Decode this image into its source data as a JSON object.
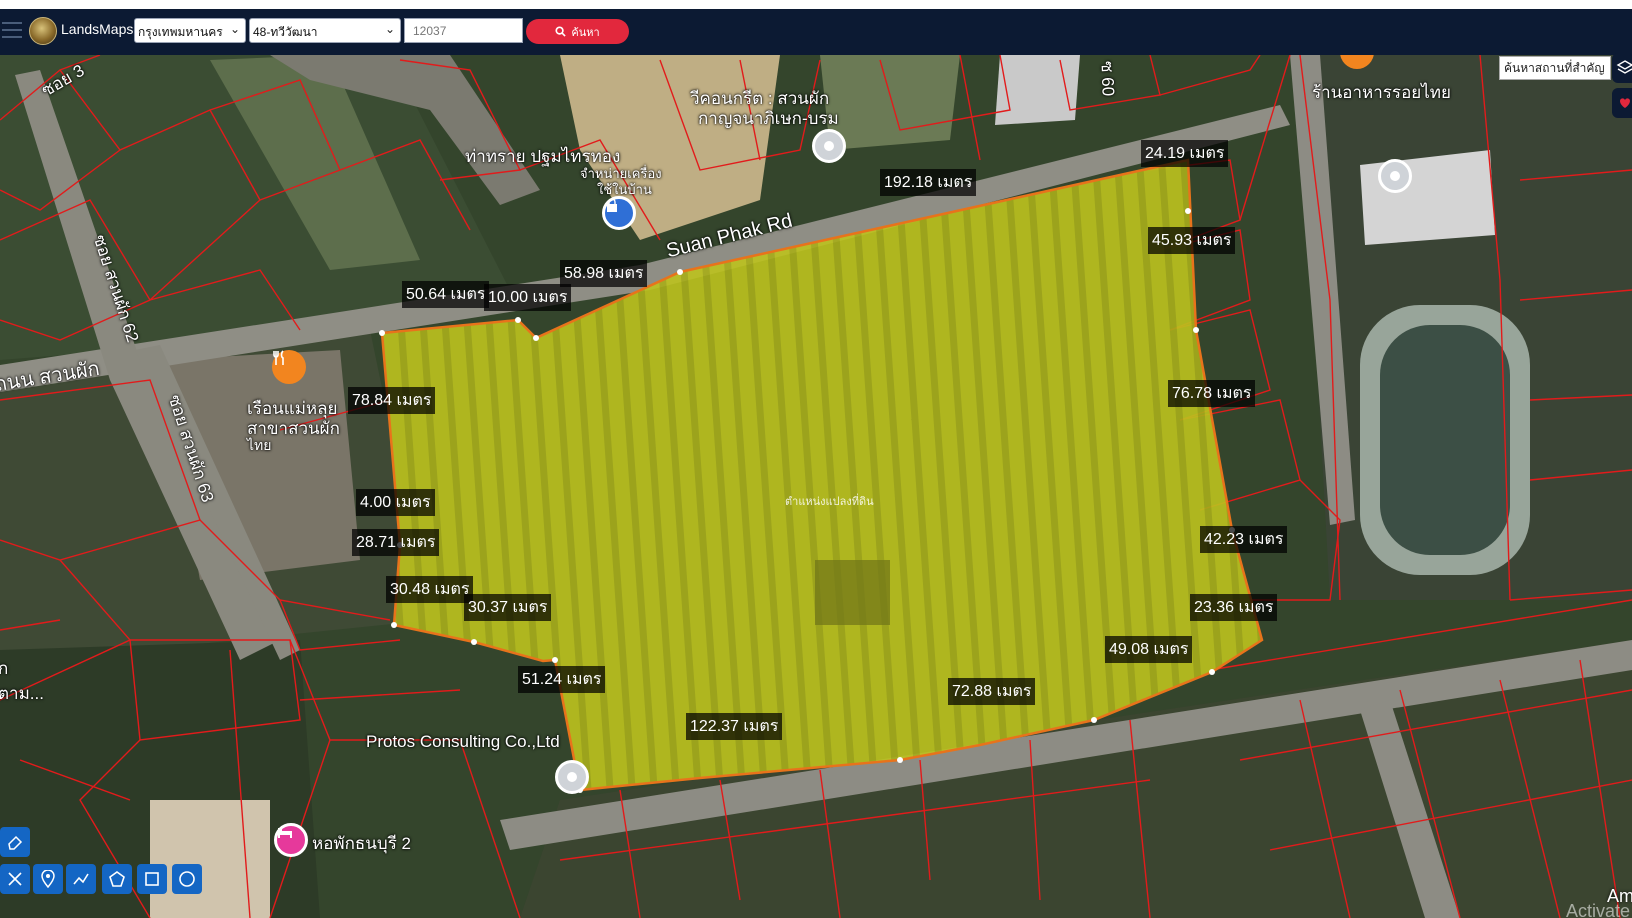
{
  "app": {
    "name": "LandsMaps"
  },
  "header": {
    "province": "กรุงเทพมหานคร",
    "district": "48-ทวีวัฒนา",
    "parcel_number": "12037",
    "search_label": "ค้นหา"
  },
  "map": {
    "place_search_text": "ค้นหาสถานที่สำคัญ",
    "parcel_label": "ตำแหน่งแปลงที่ดิน",
    "places": {
      "soi3": "ซอย 3",
      "soi_suanphak_62": "ซอย สวนผัก 62",
      "soi_suanphak_63": "ซอย สวนผัก 63",
      "soi60": "ซ 60",
      "suan_phak_rd": "Suan Phak Rd",
      "thanon_suanphak": "ถนน สวนผัก",
      "temple_line1": "วีคอนกรีต : สวนผัก",
      "temple_line2": "กาญจนาภิเษก-บรม",
      "sand_line1": "ท่าทราย ปฐมไทรทอง",
      "sand_line2": "จำหน่ายเครื่อง",
      "sand_line3": "ใช้ในบ้าน",
      "restaurant_line1": "เรือนแม่หลุย",
      "restaurant_line2": "สาขาสวนผัก",
      "restaurant_line3": "ไทย",
      "restaurant_right": "ร้านอาหารรอยไทย",
      "protos": "Protos Consulting Co.,Ltd",
      "dorm": "หอพักธนบุรี 2",
      "left_cut1": "ก",
      "left_cut2": "ตาม..."
    },
    "measurements": [
      "24.19 เมตร",
      "192.18 เมตร",
      "45.93 เมตร",
      "58.98 เมตร",
      "50.64 เมตร",
      "10.00 เมตร",
      "78.84 เมตร",
      "76.78 เมตร",
      "4.00 เมตร",
      "28.71 เมตร",
      "42.23 เมตร",
      "30.48 เมตร",
      "30.37 เมตร",
      "23.36 เมตร",
      "49.08 เมตร",
      "51.24 เมตร",
      "72.88 เมตร",
      "122.37 เมตร"
    ],
    "watermark": "Activate",
    "corner_text": "Am"
  }
}
